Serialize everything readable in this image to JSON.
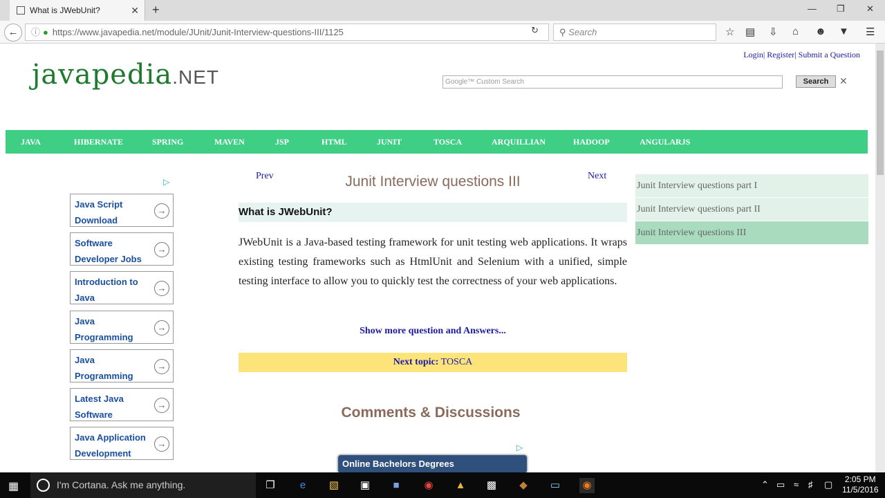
{
  "browser": {
    "tab_title": "What is JWebUnit?",
    "tab_close": "✕",
    "new_tab": "+",
    "url": "https://www.javapedia.net/module/JUnit/Junit-Interview-questions-III/1125",
    "search_placeholder": "Search"
  },
  "header": {
    "logo_main": "javapedia",
    "logo_suffix": ".NET",
    "top_links": "Login| Register| Submit a Question",
    "search_label": "Google™ Custom Search",
    "search_button": "Search",
    "search_clear": "✕"
  },
  "menu": [
    "JAVA",
    "HIBERNATE",
    "SPRING",
    "MAVEN",
    "JSP",
    "HTML",
    "JUNIT",
    "TOSCA",
    "ARQUILLIAN",
    "HADOOP",
    "ANGULARJS"
  ],
  "left_ads": [
    "Java Script Download",
    "Software Developer Jobs",
    "Introduction to Java",
    "Java Programming",
    "Java Programming",
    "Latest Java Software",
    "Java Application Development"
  ],
  "main": {
    "prev": "Prev",
    "next": "Next",
    "title": "Junit Interview questions III",
    "question": "What is JWebUnit?",
    "answer": "JWebUnit is a Java-based testing framework for unit testing web applications. It wraps existing testing frameworks such as HtmlUnit and Selenium with a unified, simple testing interface to allow you to quickly test the correctness of your web applications.",
    "show_more": "Show more question and Answers...",
    "next_topic_label": "Next topic:",
    "next_topic_value": "TOSCA",
    "comments": "Comments & Discussions",
    "ad_banner": "Online Bachelors Degrees"
  },
  "related": [
    {
      "label": "Junit Interview questions part I",
      "bg": "#e2f2e9"
    },
    {
      "label": "Junit Interview questions part II",
      "bg": "#e2f2e9"
    },
    {
      "label": "Junit Interview questions III",
      "bg": "#a9dcbf"
    }
  ],
  "taskbar": {
    "cortana": "I'm Cortana. Ask me anything.",
    "time": "2:05 PM",
    "date": "11/5/2016"
  },
  "colors": {
    "menu_bar": "#3ecf85",
    "next_topic_bg": "#fde47a",
    "link": "#1a1aa6"
  }
}
